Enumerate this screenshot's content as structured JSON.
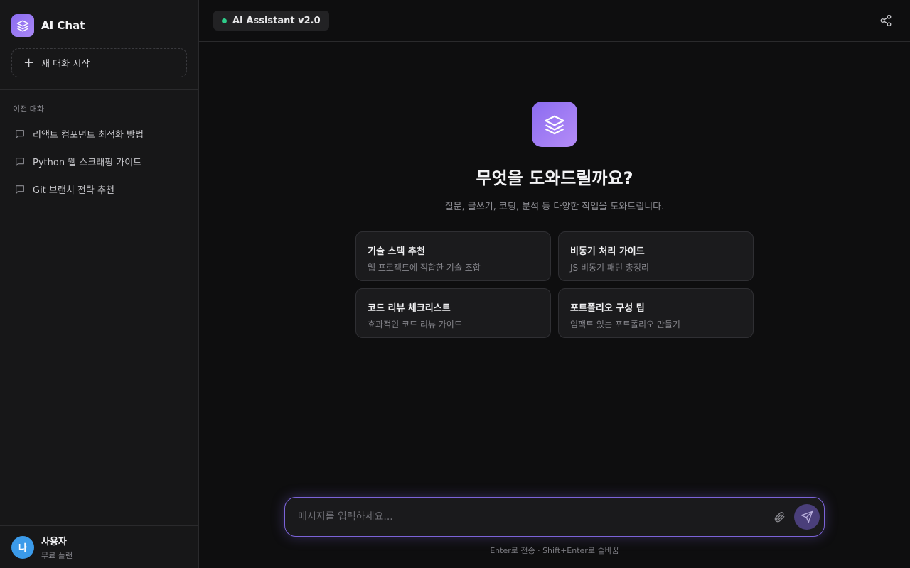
{
  "sidebar": {
    "brand_title": "AI Chat",
    "new_chat_label": "새 대화 시작",
    "section_label": "이전 대화",
    "conversations": [
      {
        "label": "리액트 컴포넌트 최적화 방법"
      },
      {
        "label": "Python 웹 스크래핑 가이드"
      },
      {
        "label": "Git 브랜치 전략 추천"
      }
    ],
    "user": {
      "avatar_text": "나",
      "name": "사용자",
      "plan": "무료 플랜"
    }
  },
  "header": {
    "model_label": "AI Assistant v2.0",
    "status_color": "#2ecc8a"
  },
  "hero": {
    "title": "무엇을 도와드릴까요?",
    "subtitle": "질문, 글쓰기, 코딩, 분석 등 다양한 작업을 도와드립니다."
  },
  "suggestions": [
    {
      "title": "기술 스택 추천",
      "desc": "웹 프로젝트에 적합한 기술 조합"
    },
    {
      "title": "비동기 처리 가이드",
      "desc": "JS 비동기 패턴 총정리"
    },
    {
      "title": "코드 리뷰 체크리스트",
      "desc": "효과적인 코드 리뷰 가이드"
    },
    {
      "title": "포트폴리오 구성 팁",
      "desc": "임팩트 있는 포트폴리오 만들기"
    }
  ],
  "composer": {
    "placeholder": "메시지를 입력하세요...",
    "hint": "Enter로 전송 · Shift+Enter로 줄바꿈"
  },
  "colors": {
    "accent": "#8b6cf0",
    "background": "#0e0e0f",
    "sidebar": "#171718"
  }
}
